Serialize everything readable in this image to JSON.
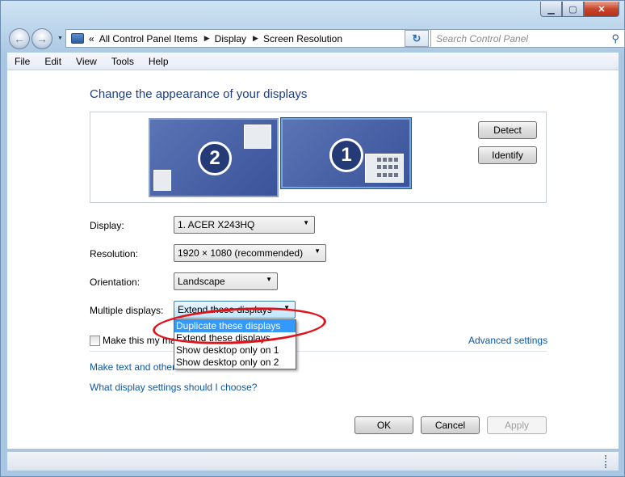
{
  "address": {
    "overflow": "«",
    "segments": [
      "All Control Panel Items",
      "Display",
      "Screen Resolution"
    ]
  },
  "search": {
    "placeholder": "Search Control Panel"
  },
  "menu": [
    "File",
    "Edit",
    "View",
    "Tools",
    "Help"
  ],
  "heading": "Change the appearance of your displays",
  "monitors": [
    {
      "number": "2",
      "selected": false
    },
    {
      "number": "1",
      "selected": true
    }
  ],
  "buttons": {
    "detect": "Detect",
    "identify": "Identify",
    "ok": "OK",
    "cancel": "Cancel",
    "apply": "Apply"
  },
  "fields": {
    "display_label": "Display:",
    "display_value": "1. ACER X243HQ",
    "resolution_label": "Resolution:",
    "resolution_value": "1920 × 1080 (recommended)",
    "orientation_label": "Orientation:",
    "orientation_value": "Landscape",
    "multiple_label": "Multiple displays:",
    "multiple_value": "Extend these displays"
  },
  "dropdown_options": [
    "Duplicate these displays",
    "Extend these displays",
    "Show desktop only on 1",
    "Show desktop only on 2"
  ],
  "checkbox_label_visible": "Make this my ma",
  "links": {
    "advanced": "Advanced settings",
    "text_size_visible": "Make text and other",
    "which_settings": "What display settings should I choose?"
  },
  "colors": {
    "highlight": "#3399ff",
    "link": "#0b58a8",
    "annotation": "#e0121b"
  }
}
